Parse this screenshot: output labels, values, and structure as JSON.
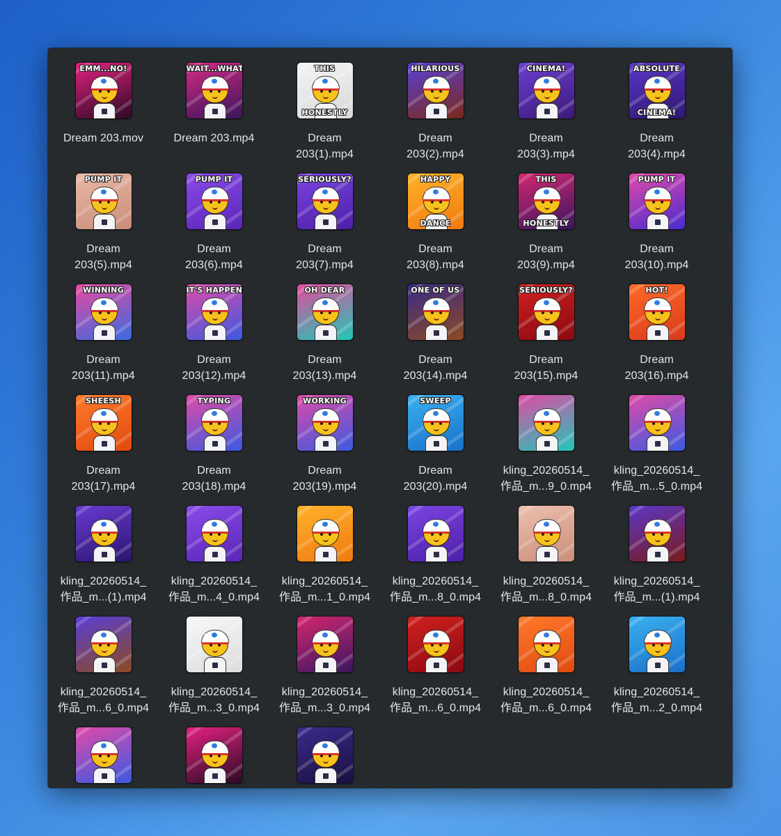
{
  "window": {
    "files": [
      {
        "name1": "Dream 203.mov",
        "name2": "",
        "thumb_title": "EMM...NO!",
        "bg": [
          "#e3217e",
          "#2b0a25"
        ]
      },
      {
        "name1": "Dream 203.mp4",
        "name2": "",
        "thumb_title": "WAIT...WHAT?",
        "bg": [
          "#d62a86",
          "#3a145a"
        ]
      },
      {
        "name1": "Dream",
        "name2": "203(1).mp4",
        "thumb_title": "THIS",
        "thumb_title_bottom": "HONESTLY",
        "bg": [
          "#f4f4f4",
          "#d9d9d9"
        ]
      },
      {
        "name1": "Dream",
        "name2": "203(2).mp4",
        "thumb_title": "HILARIOUS",
        "bg": [
          "#5a3fd6",
          "#7a2a1a"
        ]
      },
      {
        "name1": "Dream",
        "name2": "203(3).mp4",
        "thumb_title": "CINEMA!",
        "bg": [
          "#6a3fd0",
          "#3d1a7a"
        ]
      },
      {
        "name1": "Dream",
        "name2": "203(4).mp4",
        "thumb_title": "ABSOLUTE",
        "thumb_title_bottom": "CINEMA!",
        "bg": [
          "#5b37c8",
          "#2e1770"
        ]
      },
      {
        "name1": "Dream",
        "name2": "203(5).mp4",
        "thumb_title": "PUMP IT",
        "bg": [
          "#e9b8a6",
          "#c98d7a"
        ]
      },
      {
        "name1": "Dream",
        "name2": "203(6).mp4",
        "thumb_title": "PUMP IT",
        "bg": [
          "#8a4be8",
          "#5a26b8"
        ]
      },
      {
        "name1": "Dream",
        "name2": "203(7).mp4",
        "thumb_title": "SERIOUSLY?",
        "bg": [
          "#7b45e0",
          "#4c1fa8"
        ]
      },
      {
        "name1": "Dream",
        "name2": "203(8).mp4",
        "thumb_title": "HAPPY",
        "thumb_title_bottom": "DANCE",
        "bg": [
          "#ffb22a",
          "#f07a10"
        ]
      },
      {
        "name1": "Dream",
        "name2": "203(9).mp4",
        "thumb_title": "THIS",
        "thumb_title_bottom": "HONESTLY",
        "bg": [
          "#d42670",
          "#3a1660"
        ]
      },
      {
        "name1": "Dream",
        "name2": "203(10).mp4",
        "thumb_title": "PUMP IT",
        "bg": [
          "#e04aa8",
          "#4a2bd0"
        ]
      },
      {
        "name1": "Dream",
        "name2": "203(11).mp4",
        "thumb_title": "WINNING",
        "bg": [
          "#e84aa0",
          "#3a6ae0"
        ]
      },
      {
        "name1": "Dream",
        "name2": "203(12).mp4",
        "thumb_title": "IT'S HAPPENING",
        "bg": [
          "#e04aa8",
          "#3a5ae0"
        ]
      },
      {
        "name1": "Dream",
        "name2": "203(13).mp4",
        "thumb_title": "OH DEAR",
        "bg": [
          "#e24a9a",
          "#20c8b8"
        ]
      },
      {
        "name1": "Dream",
        "name2": "203(14).mp4",
        "thumb_title": "ONE OF US",
        "bg": [
          "#3a2a8a",
          "#8a4a20"
        ]
      },
      {
        "name1": "Dream",
        "name2": "203(15).mp4",
        "thumb_title": "SERIOUSLY?",
        "bg": [
          "#d02020",
          "#8a0a10"
        ]
      },
      {
        "name1": "Dream",
        "name2": "203(16).mp4",
        "thumb_title": "HOT!",
        "bg": [
          "#ff6a2a",
          "#d83a1a"
        ]
      },
      {
        "name1": "Dream",
        "name2": "203(17).mp4",
        "thumb_title": "SHEESH",
        "bg": [
          "#ff7a2a",
          "#e04a10"
        ]
      },
      {
        "name1": "Dream",
        "name2": "203(18).mp4",
        "thumb_title": "TYPING",
        "bg": [
          "#e04aa8",
          "#3a5ae0"
        ]
      },
      {
        "name1": "Dream",
        "name2": "203(19).mp4",
        "thumb_title": "WORKING",
        "bg": [
          "#e04aa8",
          "#3a5ae0"
        ]
      },
      {
        "name1": "Dream",
        "name2": "203(20).mp4",
        "thumb_title": "SWEEP",
        "bg": [
          "#3ab0f0",
          "#1a70c8"
        ]
      },
      {
        "name1": "kling_20260514_",
        "name2": "作品_m...9_0.mp4",
        "thumb_title": "",
        "bg": [
          "#e04aa8",
          "#20c8b8"
        ]
      },
      {
        "name1": "kling_20260514_",
        "name2": "作品_m...5_0.mp4",
        "thumb_title": "",
        "bg": [
          "#e04aa8",
          "#3a5ae0"
        ]
      },
      {
        "name1": "kling_20260514_",
        "name2": "作品_m...(1).mp4",
        "thumb_title": "",
        "bg": [
          "#6a3ad0",
          "#2a1670"
        ]
      },
      {
        "name1": "kling_20260514_",
        "name2": "作品_m...4_0.mp4",
        "thumb_title": "",
        "bg": [
          "#8a4be8",
          "#5a26b8"
        ]
      },
      {
        "name1": "kling_20260514_",
        "name2": "作品_m...1_0.mp4",
        "thumb_title": "",
        "bg": [
          "#ffb22a",
          "#f07a10"
        ]
      },
      {
        "name1": "kling_20260514_",
        "name2": "作品_m...8_0.mp4",
        "thumb_title": "",
        "bg": [
          "#7b45e0",
          "#4c1fa8"
        ]
      },
      {
        "name1": "kling_20260514_",
        "name2": "作品_m...8_0.mp4",
        "thumb_title": "",
        "bg": [
          "#eec0ae",
          "#c98d7a"
        ]
      },
      {
        "name1": "kling_20260514_",
        "name2": "作品_m...(1).mp4",
        "thumb_title": "",
        "bg": [
          "#5b37c8",
          "#7a1a1a"
        ]
      },
      {
        "name1": "kling_20260514_",
        "name2": "作品_m...6_0.mp4",
        "thumb_title": "",
        "bg": [
          "#5a3fd6",
          "#8a4a20"
        ]
      },
      {
        "name1": "kling_20260514_",
        "name2": "作品_m...3_0.mp4",
        "thumb_title": "",
        "bg": [
          "#f7f7f7",
          "#dddddd"
        ]
      },
      {
        "name1": "kling_20260514_",
        "name2": "作品_m...3_0.mp4",
        "thumb_title": "",
        "bg": [
          "#d42670",
          "#3a1660"
        ]
      },
      {
        "name1": "kling_20260514_",
        "name2": "作品_m...6_0.mp4",
        "thumb_title": "",
        "bg": [
          "#d02020",
          "#8a0a10"
        ]
      },
      {
        "name1": "kling_20260514_",
        "name2": "作品_m...6_0.mp4",
        "thumb_title": "",
        "bg": [
          "#ff7a2a",
          "#e04a10"
        ]
      },
      {
        "name1": "kling_20260514_",
        "name2": "作品_m...2_0.mp4",
        "thumb_title": "",
        "bg": [
          "#3ab0f0",
          "#1a70c8"
        ]
      },
      {
        "name1": "",
        "name2": "",
        "thumb_title": "",
        "bg": [
          "#e04aa8",
          "#3a5ae0"
        ]
      },
      {
        "name1": "",
        "name2": "",
        "thumb_title": "",
        "bg": [
          "#e3217e",
          "#2b0a25"
        ]
      },
      {
        "name1": "",
        "name2": "",
        "thumb_title": "",
        "bg": [
          "#3a2a8a",
          "#1a1040"
        ]
      }
    ]
  }
}
